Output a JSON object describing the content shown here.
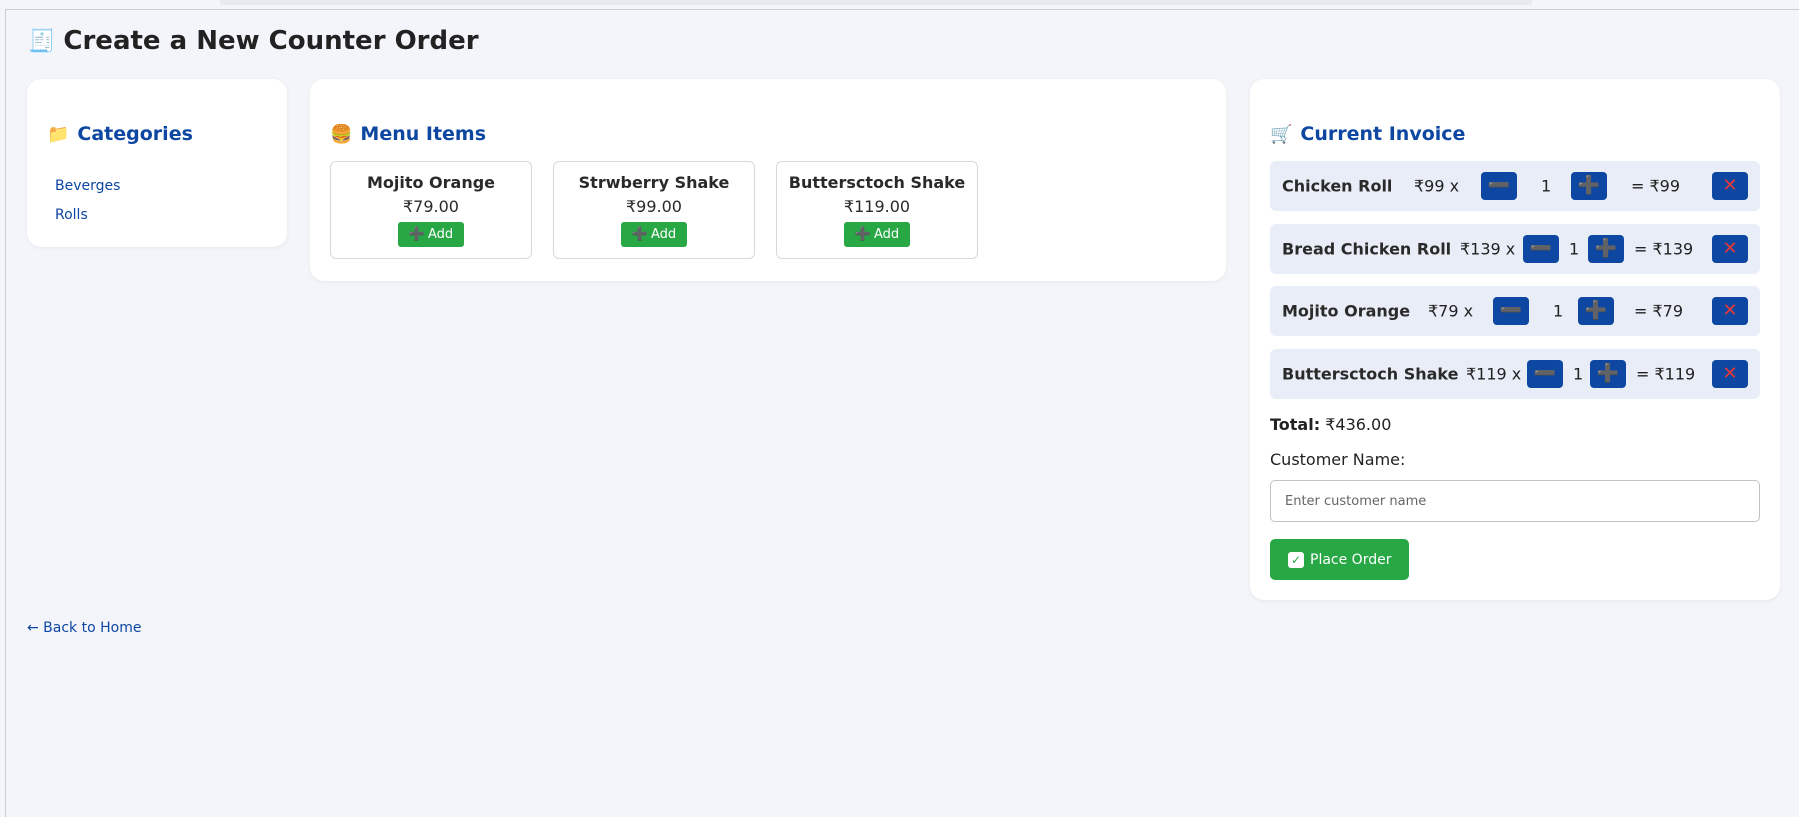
{
  "page": {
    "title": "Create a New Counter Order",
    "title_icon": "receipt-icon"
  },
  "categories": {
    "heading": "Categories",
    "heading_icon": "folder-icon",
    "items": [
      "Beverges",
      "Rolls"
    ]
  },
  "menu": {
    "heading": "Menu Items",
    "heading_icon": "burger-icon",
    "add_label": "Add",
    "items": [
      {
        "name": "Mojito Orange",
        "price": "₹79.00"
      },
      {
        "name": "Strwberry Shake",
        "price": "₹99.00"
      },
      {
        "name": "Buttersctoch Shake",
        "price": "₹119.00"
      }
    ]
  },
  "invoice": {
    "heading": "Current Invoice",
    "heading_icon": "cart-icon",
    "items": [
      {
        "name": "Chicken Roll",
        "unit": "₹99 x",
        "qty": "1",
        "subtotal": "= ₹99"
      },
      {
        "name": "Bread Chicken Roll",
        "unit": "₹139 x",
        "qty": "1",
        "subtotal": "= ₹139"
      },
      {
        "name": "Mojito Orange",
        "unit": "₹79 x",
        "qty": "1",
        "subtotal": "= ₹79"
      },
      {
        "name": "Buttersctoch Shake",
        "unit": "₹119 x",
        "qty": "1",
        "subtotal": "= ₹119"
      }
    ],
    "total_label": "Total:",
    "total_value": "₹436.00",
    "customer_label": "Customer Name:",
    "customer_placeholder": "Enter customer name",
    "place_order_label": "Place Order"
  },
  "footer": {
    "back_link": "← Back to Home"
  },
  "colors": {
    "accent": "#0d47a1",
    "success": "#28a745",
    "background": "#f3f5fa",
    "row_bg": "#e8edf7"
  }
}
